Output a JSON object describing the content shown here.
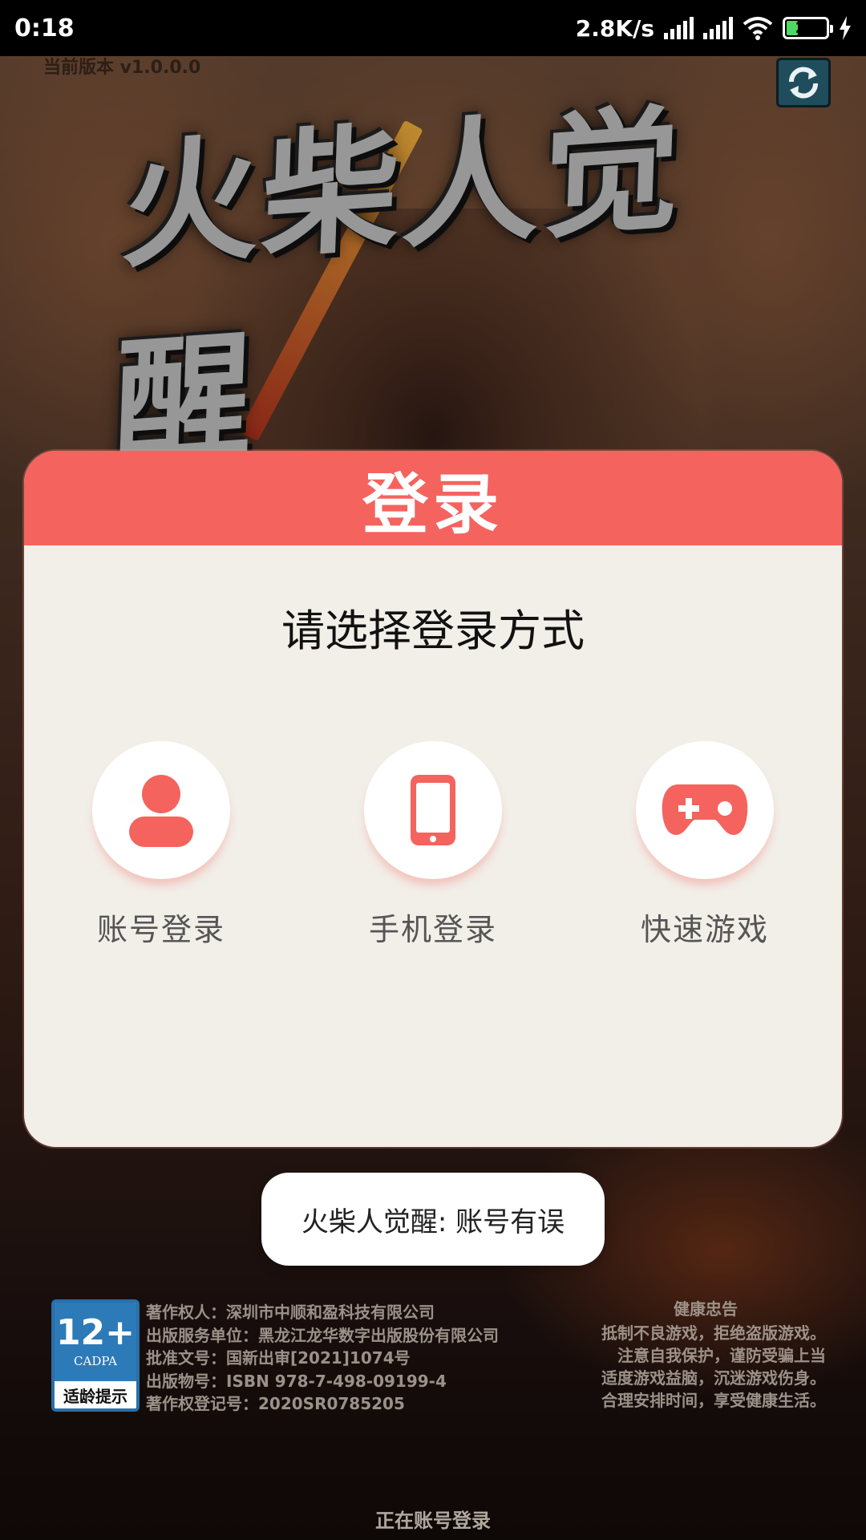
{
  "status_bar": {
    "time": "0:18",
    "net_speed": "2.8K/s",
    "battery_level": "29",
    "battery_fraction": 0.29
  },
  "game": {
    "version": "当前版本 v1.0.0.0",
    "logo_text": "火柴人觉醒"
  },
  "login_dialog": {
    "title": "登录",
    "subtitle": "请选择登录方式",
    "options": [
      {
        "label": "账号登录",
        "icon": "user-icon"
      },
      {
        "label": "手机登录",
        "icon": "phone-icon"
      },
      {
        "label": "快速游戏",
        "icon": "gamepad-icon"
      }
    ],
    "accent_color": "#f5635e"
  },
  "toast": {
    "message": "火柴人觉醒: 账号有误"
  },
  "footer": {
    "age_rating": {
      "number": "12+",
      "org": "CADPA",
      "tip": "适龄提示"
    },
    "copyright_lines": [
      "著作权人：深圳市中顺和盈科技有限公司",
      "出版服务单位：黑龙江龙华数字出版股份有限公司",
      "批准文号：国新出审[2021]1074号",
      "出版物号：ISBN 978-7-498-09199-4",
      "著作权登记号：2020SR0785205"
    ],
    "health_title": "健康忠告",
    "health_lines": [
      "抵制不良游戏，拒绝盗版游戏。",
      "注意自我保护，谨防受骗上当",
      "适度游戏益脑，沉迷游戏伤身。",
      "合理安排时间，享受健康生活。"
    ],
    "loading_status": "正在账号登录"
  }
}
